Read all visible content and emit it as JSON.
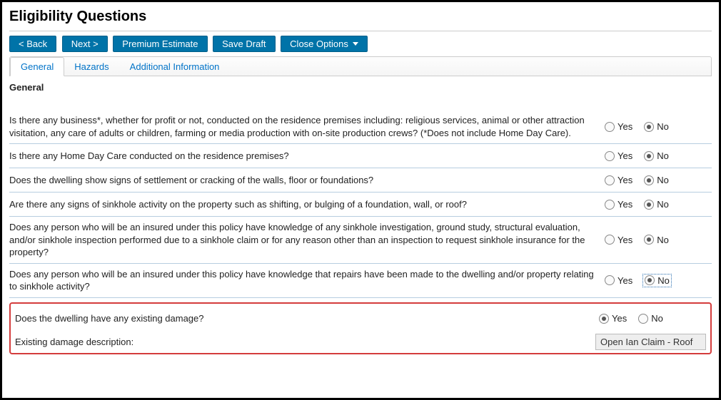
{
  "page": {
    "title": "Eligibility Questions"
  },
  "toolbar": {
    "back": "< Back",
    "next": "Next >",
    "premium": "Premium Estimate",
    "save": "Save Draft",
    "close": "Close Options"
  },
  "tabs": {
    "general": "General",
    "hazards": "Hazards",
    "additional": "Additional Information"
  },
  "section": {
    "label": "General"
  },
  "opts": {
    "yes": "Yes",
    "no": "No"
  },
  "questions": {
    "q1": {
      "text": "Is there any business*, whether for profit or not, conducted on the residence premises including: religious services, animal or other attraction visitation, any care of adults or children, farming or media production with on-site production crews? (*Does not include Home Day Care).",
      "answer": "no"
    },
    "q2": {
      "text": "Is there any Home Day Care conducted on the residence premises?",
      "answer": "no"
    },
    "q3": {
      "text": "Does the dwelling show signs of settlement or cracking of the walls, floor or foundations?",
      "answer": "no"
    },
    "q4": {
      "text": "Are there any signs of sinkhole activity on the property such as shifting, or bulging of a foundation, wall, or roof?",
      "answer": "no"
    },
    "q5": {
      "text": "Does any person who will be an insured under this policy have knowledge of any sinkhole investigation, ground study, structural evaluation, and/or sinkhole inspection performed due to a sinkhole claim or for any reason other than an inspection to request sinkhole insurance for the property?",
      "answer": "no"
    },
    "q6": {
      "text": "Does any person who will be an insured under this policy have knowledge that repairs have been made to the dwelling and/or property relating to sinkhole activity?",
      "answer": "no",
      "focused": true
    },
    "q7": {
      "text": "Does the dwelling have any existing damage?",
      "answer": "yes"
    }
  },
  "damage": {
    "label": "Existing damage description:",
    "value": "Open Ian Claim - Roof"
  }
}
